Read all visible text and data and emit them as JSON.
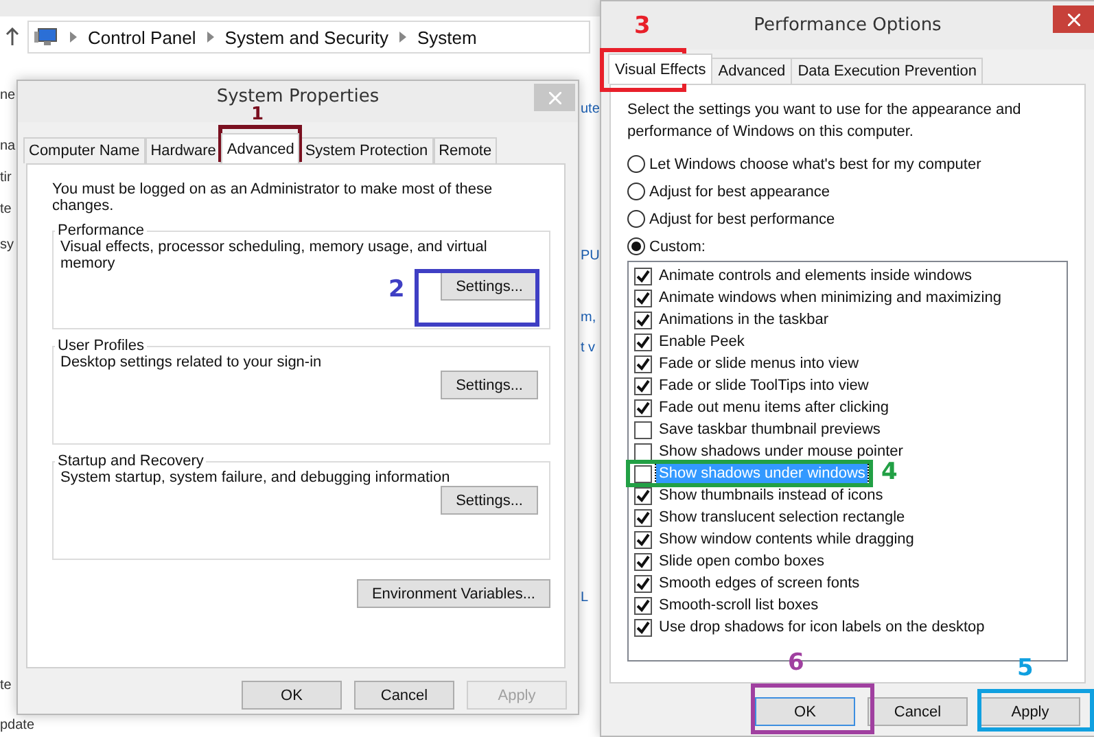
{
  "background_window": {
    "breadcrumb": [
      "Control Panel",
      "System and Security",
      "System"
    ],
    "left_fragments": [
      "ne",
      "na",
      "tir",
      "te",
      "sy",
      "te",
      "pdate"
    ],
    "right_fragments": [
      "ute",
      "PU",
      "m,",
      "t v",
      "L"
    ]
  },
  "system_properties": {
    "title": "System Properties",
    "tabs": [
      {
        "label": "Computer Name",
        "selected": false
      },
      {
        "label": "Hardware",
        "selected": false
      },
      {
        "label": "Advanced",
        "selected": true
      },
      {
        "label": "System Protection",
        "selected": false
      },
      {
        "label": "Remote",
        "selected": false
      }
    ],
    "notice": "You must be logged on as an Administrator to make most of these changes.",
    "groups": [
      {
        "title": "Performance",
        "description": "Visual effects, processor scheduling, memory usage, and virtual memory",
        "button": "Settings..."
      },
      {
        "title": "User Profiles",
        "description": "Desktop settings related to your sign-in",
        "button": "Settings..."
      },
      {
        "title": "Startup and Recovery",
        "description": "System startup, system failure, and debugging information",
        "button": "Settings..."
      }
    ],
    "env_button": "Environment Variables...",
    "buttons": [
      {
        "label": "OK",
        "disabled": false
      },
      {
        "label": "Cancel",
        "disabled": false
      },
      {
        "label": "Apply",
        "disabled": true
      }
    ]
  },
  "performance_options": {
    "title": "Performance Options",
    "tabs": [
      {
        "label": "Visual Effects",
        "selected": true
      },
      {
        "label": "Advanced",
        "selected": false
      },
      {
        "label": "Data Execution Prevention",
        "selected": false
      }
    ],
    "description": "Select the settings you want to use for the appearance and performance of Windows on this computer.",
    "modes": [
      {
        "label": "Let Windows choose what's best for my computer",
        "selected": false
      },
      {
        "label": "Adjust for best appearance",
        "selected": false
      },
      {
        "label": "Adjust for best performance",
        "selected": false
      },
      {
        "label": "Custom:",
        "selected": true
      }
    ],
    "effects": [
      {
        "label": "Animate controls and elements inside windows",
        "checked": true,
        "selected": false
      },
      {
        "label": "Animate windows when minimizing and maximizing",
        "checked": true,
        "selected": false
      },
      {
        "label": "Animations in the taskbar",
        "checked": true,
        "selected": false
      },
      {
        "label": "Enable Peek",
        "checked": true,
        "selected": false
      },
      {
        "label": "Fade or slide menus into view",
        "checked": true,
        "selected": false
      },
      {
        "label": "Fade or slide ToolTips into view",
        "checked": true,
        "selected": false
      },
      {
        "label": "Fade out menu items after clicking",
        "checked": true,
        "selected": false
      },
      {
        "label": "Save taskbar thumbnail previews",
        "checked": false,
        "selected": false
      },
      {
        "label": "Show shadows under mouse pointer",
        "checked": false,
        "selected": false
      },
      {
        "label": "Show shadows under windows",
        "checked": false,
        "selected": true
      },
      {
        "label": "Show thumbnails instead of icons",
        "checked": true,
        "selected": false
      },
      {
        "label": "Show translucent selection rectangle",
        "checked": true,
        "selected": false
      },
      {
        "label": "Show window contents while dragging",
        "checked": true,
        "selected": false
      },
      {
        "label": "Slide open combo boxes",
        "checked": true,
        "selected": false
      },
      {
        "label": "Smooth edges of screen fonts",
        "checked": true,
        "selected": false
      },
      {
        "label": "Smooth-scroll list boxes",
        "checked": true,
        "selected": false
      },
      {
        "label": "Use drop shadows for icon labels on the desktop",
        "checked": true,
        "selected": false
      }
    ],
    "buttons": [
      {
        "label": "OK",
        "default": true
      },
      {
        "label": "Cancel",
        "default": false
      },
      {
        "label": "Apply",
        "default": false
      }
    ]
  },
  "annotations": [
    {
      "number": "1",
      "color": "#7a1020"
    },
    {
      "number": "2",
      "color": "#3f3fc4"
    },
    {
      "number": "3",
      "color": "#e8202a"
    },
    {
      "number": "4",
      "color": "#22a045"
    },
    {
      "number": "5",
      "color": "#10a0e0"
    },
    {
      "number": "6",
      "color": "#a040a0"
    }
  ]
}
